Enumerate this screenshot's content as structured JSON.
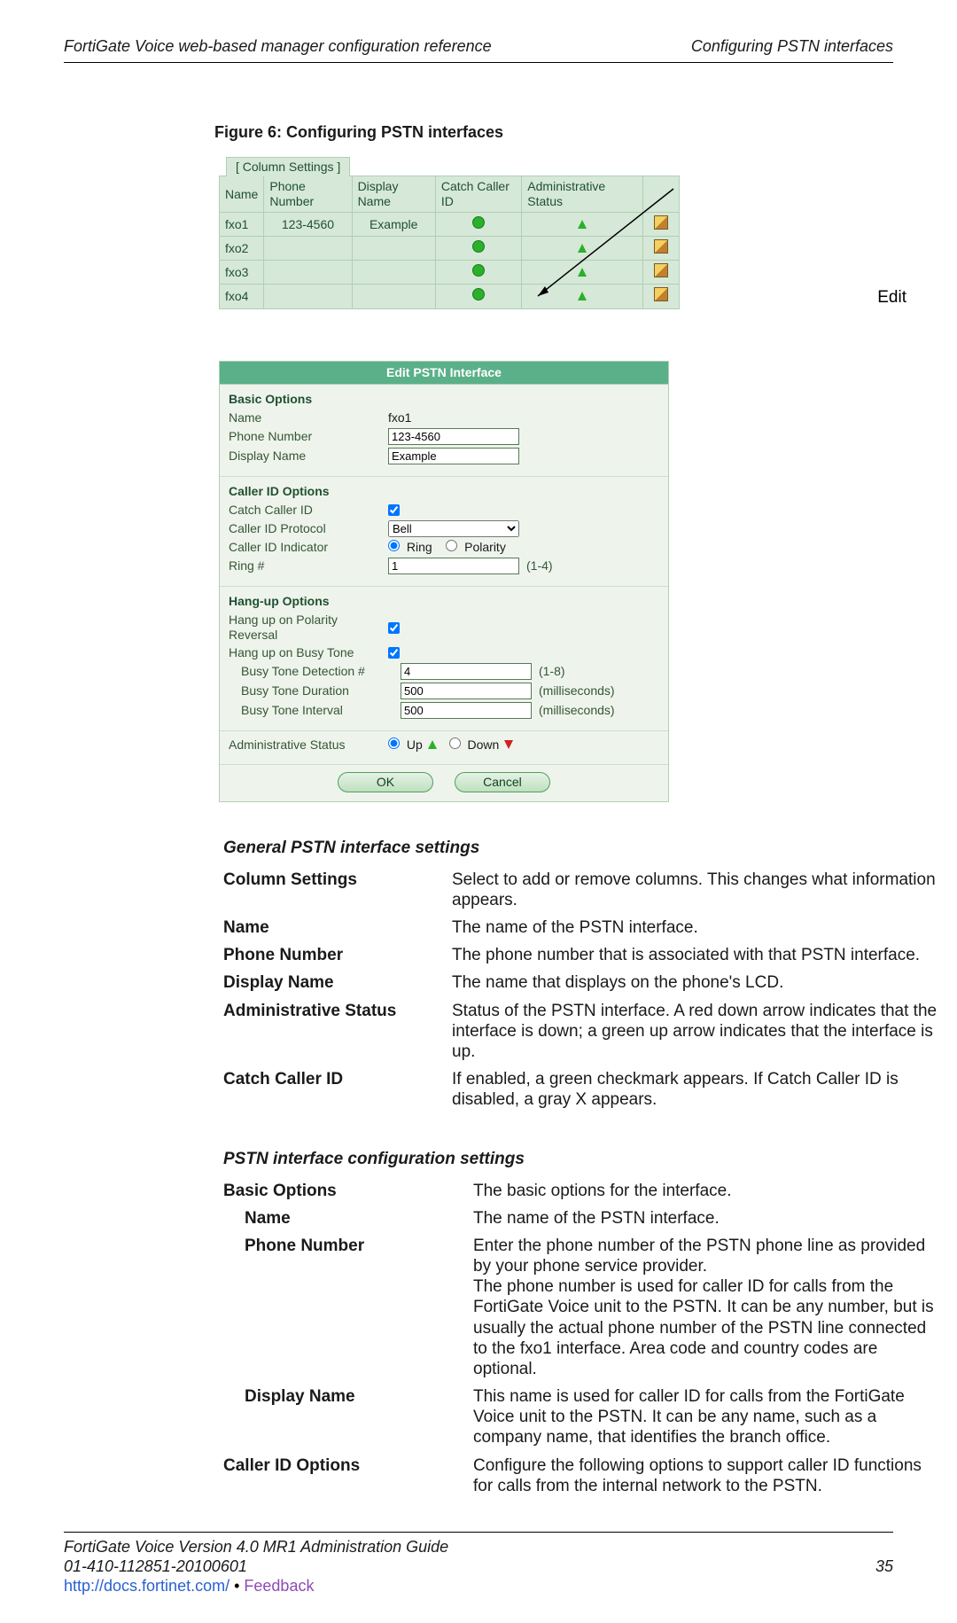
{
  "header": {
    "left": "FortiGate Voice web-based manager configuration reference",
    "right": "Configuring PSTN interfaces"
  },
  "figure": {
    "caption": "Figure 6: Configuring PSTN interfaces",
    "column_tab": "[ Column Settings ]",
    "columns": [
      "Name",
      "Phone Number",
      "Display Name",
      "Catch Caller ID",
      "Administrative Status"
    ],
    "rows": [
      {
        "name": "fxo1",
        "phone": "123-4560",
        "display": "Example"
      },
      {
        "name": "fxo2",
        "phone": "",
        "display": ""
      },
      {
        "name": "fxo3",
        "phone": "",
        "display": ""
      },
      {
        "name": "fxo4",
        "phone": "",
        "display": ""
      }
    ],
    "edit_label": "Edit"
  },
  "edit_panel": {
    "title": "Edit PSTN Interface",
    "basic": {
      "heading": "Basic Options",
      "name_label": "Name",
      "name_value": "fxo1",
      "phone_label": "Phone Number",
      "phone_value": "123-4560",
      "display_label": "Display Name",
      "display_value": "Example"
    },
    "caller": {
      "heading": "Caller ID Options",
      "catch_label": "Catch Caller ID",
      "proto_label": "Caller ID Protocol",
      "proto_value": "Bell",
      "ind_label": "Caller ID Indicator",
      "ind_ring": "Ring",
      "ind_pol": "Polarity",
      "ring_label": "Ring #",
      "ring_value": "1",
      "ring_hint": "(1-4)"
    },
    "hang": {
      "heading": "Hang-up Options",
      "pol_label": "Hang up on Polarity Reversal",
      "busy_label": "Hang up on Busy Tone",
      "det_label": "Busy Tone Detection #",
      "det_value": "4",
      "det_hint": "(1-8)",
      "dur_label": "Busy Tone Duration",
      "dur_value": "500",
      "dur_hint": "(milliseconds)",
      "int_label": "Busy Tone Interval",
      "int_value": "500",
      "int_hint": "(milliseconds)"
    },
    "admin": {
      "label": "Administrative Status",
      "up": "Up",
      "down": "Down"
    },
    "ok": "OK",
    "cancel": "Cancel"
  },
  "defs1": {
    "heading": "General PSTN interface settings",
    "rows": [
      {
        "term": "Column Settings",
        "desc": "Select to add or remove columns. This changes what information appears."
      },
      {
        "term": "Name",
        "desc": "The name of the PSTN interface."
      },
      {
        "term": "Phone Number",
        "desc": "The phone number that is associated with that PSTN interface."
      },
      {
        "term": "Display Name",
        "desc": "The name that displays on the phone's LCD."
      },
      {
        "term": "Administrative Status",
        "desc": "Status of the PSTN interface. A red down arrow indicates that the interface is down; a green up arrow indicates that the interface is up."
      },
      {
        "term": "Catch Caller ID",
        "desc": "If enabled, a green checkmark appears. If Catch Caller ID is disabled, a gray X appears."
      }
    ]
  },
  "defs2": {
    "heading": "PSTN interface configuration settings",
    "rows": [
      {
        "term": "Basic Options",
        "desc": "The basic options for the interface.",
        "indent": false
      },
      {
        "term": "Name",
        "desc": "The name of the PSTN interface.",
        "indent": true
      },
      {
        "term": "Phone Number",
        "desc": "Enter the phone number of the PSTN phone line as provided by your phone service provider.\nThe phone number is used for caller ID for calls from the FortiGate Voice unit to the PSTN. It can be any number, but is usually the actual phone number of the PSTN line connected to the fxo1 interface. Area code and country codes are optional.",
        "indent": true
      },
      {
        "term": "Display Name",
        "desc": "This name is used for caller ID for calls from the FortiGate Voice unit to the PSTN. It can be any name, such as a company name, that identifies the branch office.",
        "indent": true
      },
      {
        "term": "Caller ID Options",
        "desc": "Configure the following options to support caller ID functions for calls from the internal network to the PSTN.",
        "indent": false
      }
    ]
  },
  "footer": {
    "line1": "FortiGate Voice Version 4.0 MR1 Administration Guide",
    "line2": "01-410-112851-20100601",
    "page": "35",
    "link": "http://docs.fortinet.com/",
    "sep": " • ",
    "feedback": "Feedback"
  }
}
